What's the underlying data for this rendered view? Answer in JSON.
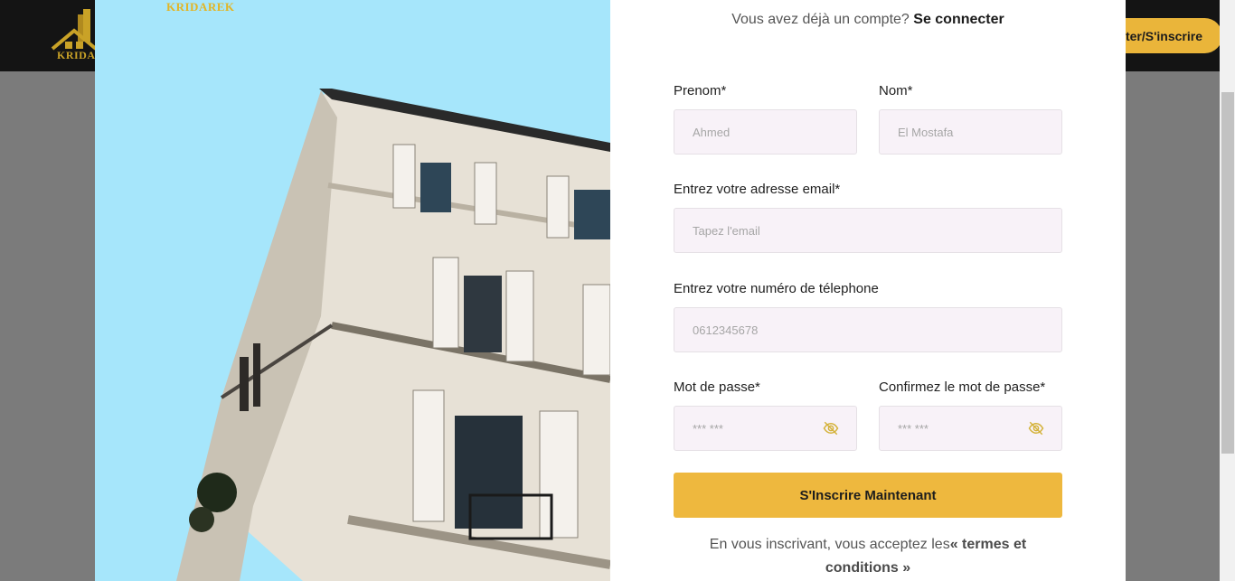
{
  "header": {
    "logo_text": "KRIDA",
    "login_button_label": "ter/S'inscrire"
  },
  "modal": {
    "logo_text": "KRIDAREK",
    "have_account_text": "Vous avez déjà un compte?",
    "login_link": "Se connecter",
    "fields": {
      "first_name": {
        "label": "Prenom*",
        "placeholder": "Ahmed"
      },
      "last_name": {
        "label": "Nom*",
        "placeholder": "El Mostafa"
      },
      "email": {
        "label": "Entrez votre adresse email*",
        "placeholder": "Tapez l'email"
      },
      "phone": {
        "label": "Entrez votre numéro de télephone",
        "placeholder": "0612345678"
      },
      "password": {
        "label": "Mot de passe*",
        "placeholder": "*** ***"
      },
      "confirm_password": {
        "label": "Confirmez le mot de passe*",
        "placeholder": "*** ***"
      }
    },
    "submit_label": "S'Inscrire Maintenant",
    "terms_text": "En vous inscrivant, vous acceptez les",
    "terms_link": "« termes et conditions »"
  },
  "icons": {
    "password_toggle": "eye-off-icon",
    "confirm_toggle": "eye-off-icon",
    "logo": "house-logo-icon"
  },
  "colors": {
    "accent": "#eeb83e",
    "sky": "#a6e6fb",
    "field_bg": "#f8f2f8",
    "topbar": "#141414",
    "overlay": "#7b7b7b"
  }
}
